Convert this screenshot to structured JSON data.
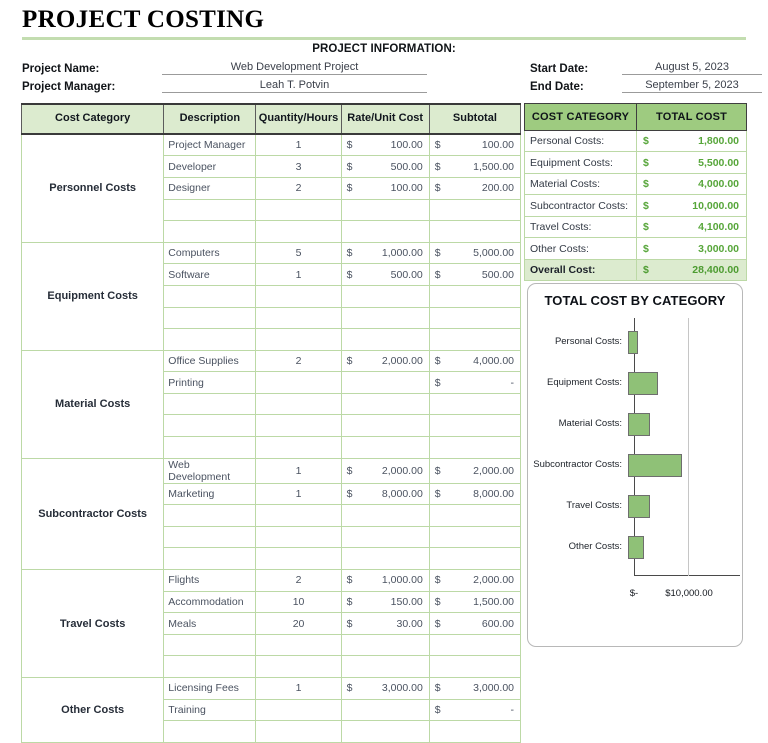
{
  "document": {
    "title": "PROJECT COSTING"
  },
  "project_information": {
    "heading": "PROJECT INFORMATION:",
    "project_name_label": "Project Name:",
    "project_name_value": "Web Development Project",
    "project_manager_label": "Project Manager:",
    "project_manager_value": "Leah T. Potvin",
    "start_date_label": "Start Date:",
    "start_date_value": "August 5, 2023",
    "end_date_label": "End Date:",
    "end_date_value": "September 5, 2023"
  },
  "cost_table": {
    "headers": {
      "category": "Cost Category",
      "description": "Description",
      "quantity": "Quantity/Hours",
      "rate": "Rate/Unit Cost",
      "subtotal": "Subtotal"
    },
    "currency_symbol": "$",
    "blocks": [
      {
        "category": "Personnel Costs",
        "rows": [
          {
            "description": "Project Manager",
            "quantity": "1",
            "rate": "100.00",
            "subtotal": "100.00"
          },
          {
            "description": "Developer",
            "quantity": "3",
            "rate": "500.00",
            "subtotal": "1,500.00"
          },
          {
            "description": "Designer",
            "quantity": "2",
            "rate": "100.00",
            "subtotal": "200.00"
          },
          {
            "description": "",
            "quantity": "",
            "rate": "",
            "subtotal": ""
          },
          {
            "description": "",
            "quantity": "",
            "rate": "",
            "subtotal": ""
          }
        ]
      },
      {
        "category": "Equipment Costs",
        "rows": [
          {
            "description": "Computers",
            "quantity": "5",
            "rate": "1,000.00",
            "subtotal": "5,000.00"
          },
          {
            "description": "Software",
            "quantity": "1",
            "rate": "500.00",
            "subtotal": "500.00"
          },
          {
            "description": "",
            "quantity": "",
            "rate": "",
            "subtotal": ""
          },
          {
            "description": "",
            "quantity": "",
            "rate": "",
            "subtotal": ""
          },
          {
            "description": "",
            "quantity": "",
            "rate": "",
            "subtotal": ""
          }
        ]
      },
      {
        "category": "Material Costs",
        "rows": [
          {
            "description": "Office Supplies",
            "quantity": "2",
            "rate": "2,000.00",
            "subtotal": "4,000.00"
          },
          {
            "description": "Printing",
            "quantity": "",
            "rate": "",
            "subtotal": "-"
          },
          {
            "description": "",
            "quantity": "",
            "rate": "",
            "subtotal": ""
          },
          {
            "description": "",
            "quantity": "",
            "rate": "",
            "subtotal": ""
          },
          {
            "description": "",
            "quantity": "",
            "rate": "",
            "subtotal": ""
          }
        ]
      },
      {
        "category": "Subcontractor Costs",
        "rows": [
          {
            "description": "Web Development",
            "quantity": "1",
            "rate": "2,000.00",
            "subtotal": "2,000.00"
          },
          {
            "description": "Marketing",
            "quantity": "1",
            "rate": "8,000.00",
            "subtotal": "8,000.00"
          },
          {
            "description": "",
            "quantity": "",
            "rate": "",
            "subtotal": ""
          },
          {
            "description": "",
            "quantity": "",
            "rate": "",
            "subtotal": ""
          },
          {
            "description": "",
            "quantity": "",
            "rate": "",
            "subtotal": ""
          }
        ]
      },
      {
        "category": "Travel Costs",
        "rows": [
          {
            "description": "Flights",
            "quantity": "2",
            "rate": "1,000.00",
            "subtotal": "2,000.00"
          },
          {
            "description": "Accommodation",
            "quantity": "10",
            "rate": "150.00",
            "subtotal": "1,500.00"
          },
          {
            "description": "Meals",
            "quantity": "20",
            "rate": "30.00",
            "subtotal": "600.00"
          },
          {
            "description": "",
            "quantity": "",
            "rate": "",
            "subtotal": ""
          },
          {
            "description": "",
            "quantity": "",
            "rate": "",
            "subtotal": ""
          }
        ]
      },
      {
        "category": "Other Costs",
        "rows": [
          {
            "description": "Licensing Fees",
            "quantity": "1",
            "rate": "3,000.00",
            "subtotal": "3,000.00"
          },
          {
            "description": "Training",
            "quantity": "",
            "rate": "",
            "subtotal": "-"
          },
          {
            "description": "",
            "quantity": "",
            "rate": "",
            "subtotal": ""
          }
        ]
      }
    ]
  },
  "summary_table": {
    "headers": {
      "category": "COST CATEGORY",
      "total": "TOTAL COST"
    },
    "currency_symbol": "$",
    "rows": [
      {
        "label": "Personal Costs:",
        "value": "1,800.00"
      },
      {
        "label": "Equipment Costs:",
        "value": "5,500.00"
      },
      {
        "label": "Material Costs:",
        "value": "4,000.00"
      },
      {
        "label": "Subcontractor Costs:",
        "value": "10,000.00"
      },
      {
        "label": "Travel Costs:",
        "value": "4,100.00"
      },
      {
        "label": "Other Costs:",
        "value": "3,000.00"
      }
    ],
    "total_row": {
      "label": "Overall Cost:",
      "value": "28,400.00"
    }
  },
  "chart_data": {
    "type": "bar",
    "orientation": "horizontal",
    "title": "TOTAL COST BY CATEGORY",
    "categories": [
      "Personal Costs:",
      "Equipment Costs:",
      "Material Costs:",
      "Subcontractor Costs:",
      "Travel Costs:",
      "Other Costs:"
    ],
    "values": [
      1800,
      5500,
      4000,
      10000,
      4100,
      3000
    ],
    "xlabel": "",
    "ylabel": "",
    "xlim": [
      0,
      10000
    ],
    "xtick_labels": [
      "$-",
      "$10,000.00"
    ],
    "xtick_values": [
      0,
      10000
    ],
    "grid": true,
    "legend": false,
    "bar_color": "#8FC177",
    "bar_border_color": "#6E6E6E"
  },
  "theme": {
    "accent_green": "#9ecb80",
    "light_green": "#dcebcf",
    "value_green": "#57a63a",
    "rule_green": "#c3ddb0"
  }
}
